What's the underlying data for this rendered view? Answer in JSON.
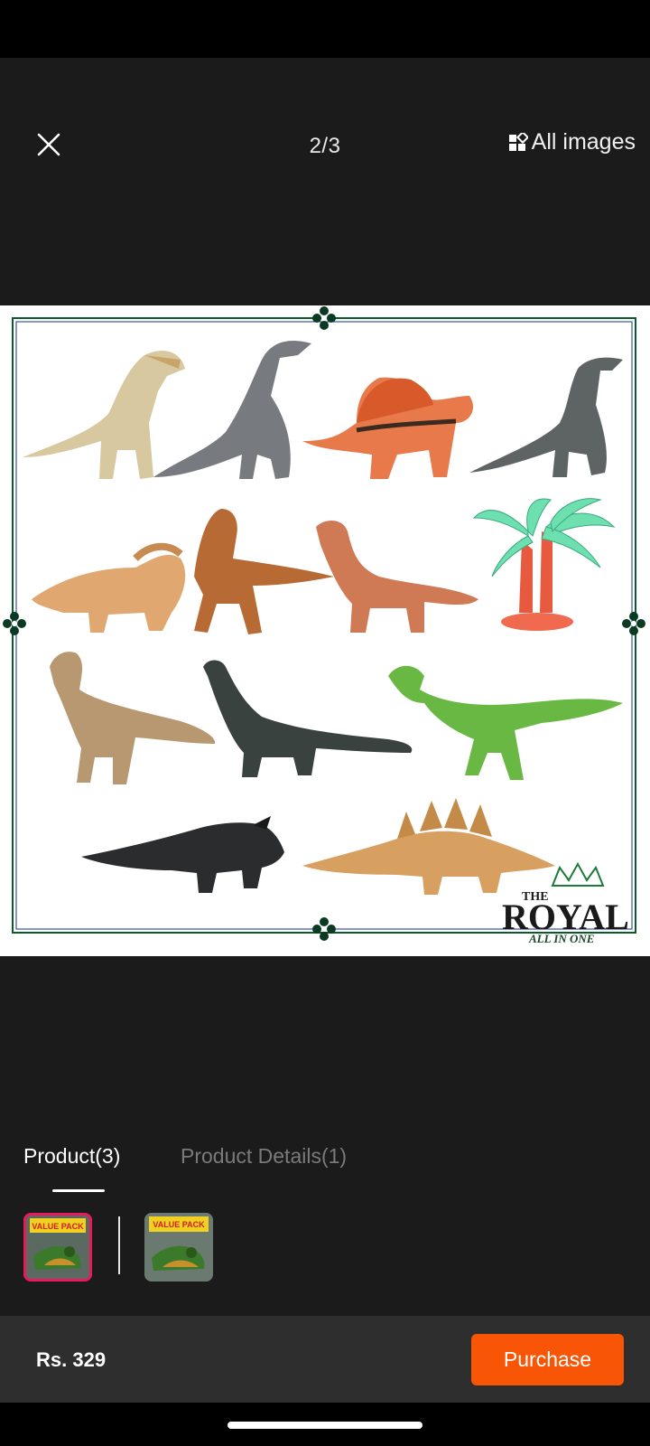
{
  "header": {
    "page_counter": "2/3",
    "all_images_label": "All images",
    "close_icon": "close-icon",
    "gallery_icon": "gallery-grid-icon"
  },
  "product_image": {
    "logo_top": "THE",
    "logo_main": "ROYAL",
    "logo_sub": "ALL IN ONE",
    "frame_color": "#0b5a2a"
  },
  "tabs": {
    "items": [
      {
        "label": "Product(3)",
        "active": true
      },
      {
        "label": "Product Details(1)",
        "active": false
      }
    ]
  },
  "thumbnails": {
    "items": [
      {
        "label": "VALUE PACK",
        "selected": true
      },
      {
        "label": "VALUE PACK",
        "selected": false
      }
    ]
  },
  "purchase_bar": {
    "price": "Rs. 329",
    "purchase_label": "Purchase",
    "accent": "#f85606"
  },
  "colors": {
    "background": "#1b1b1b",
    "selected_thumb_border": "#e8195e"
  }
}
